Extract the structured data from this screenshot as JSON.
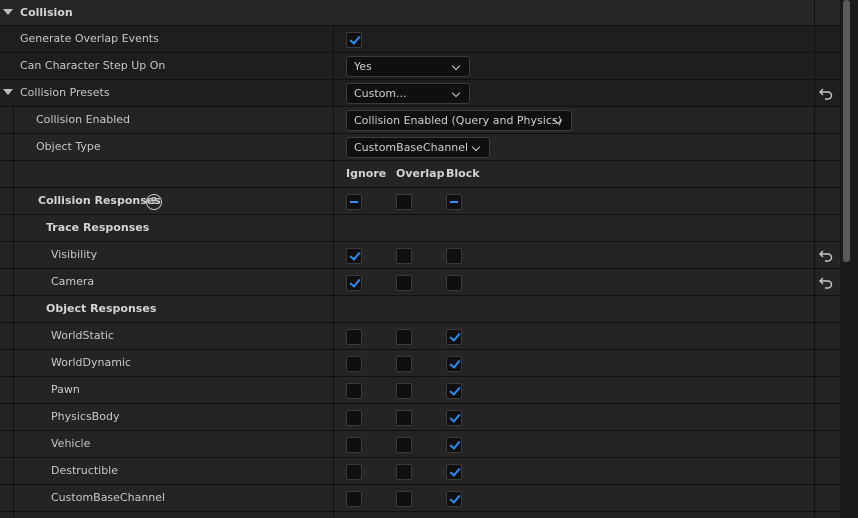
{
  "section": {
    "title": "Collision"
  },
  "generate_overlap": {
    "label": "Generate Overlap Events",
    "checked": true
  },
  "step_up": {
    "label": "Can Character Step Up On",
    "value": "Yes"
  },
  "presets": {
    "label": "Collision Presets",
    "value": "Custom..."
  },
  "collision_enabled": {
    "label": "Collision Enabled",
    "value": "Collision Enabled (Query and Physics)"
  },
  "object_type": {
    "label": "Object Type",
    "value": "CustomBaseChannel"
  },
  "columns": {
    "ignore": "Ignore",
    "overlap": "Overlap",
    "block": "Block"
  },
  "responses": {
    "label": "Collision Responses",
    "help": "?"
  },
  "trace_responses": {
    "label": "Trace Responses"
  },
  "trace": [
    {
      "label": "Visibility",
      "ignore": true,
      "overlap": false,
      "block": false,
      "reset": true
    },
    {
      "label": "Camera",
      "ignore": true,
      "overlap": false,
      "block": false,
      "reset": true
    }
  ],
  "object_responses": {
    "label": "Object Responses"
  },
  "objects": [
    {
      "label": "WorldStatic",
      "ignore": false,
      "overlap": false,
      "block": true
    },
    {
      "label": "WorldDynamic",
      "ignore": false,
      "overlap": false,
      "block": true
    },
    {
      "label": "Pawn",
      "ignore": false,
      "overlap": false,
      "block": true
    },
    {
      "label": "PhysicsBody",
      "ignore": false,
      "overlap": false,
      "block": true
    },
    {
      "label": "Vehicle",
      "ignore": false,
      "overlap": false,
      "block": true
    },
    {
      "label": "Destructible",
      "ignore": false,
      "overlap": false,
      "block": true
    },
    {
      "label": "CustomBaseChannel",
      "ignore": false,
      "overlap": false,
      "block": true
    }
  ],
  "colors": {
    "accent": "#2f8cf3",
    "background": "#1a1a1a",
    "header": "#262626"
  }
}
